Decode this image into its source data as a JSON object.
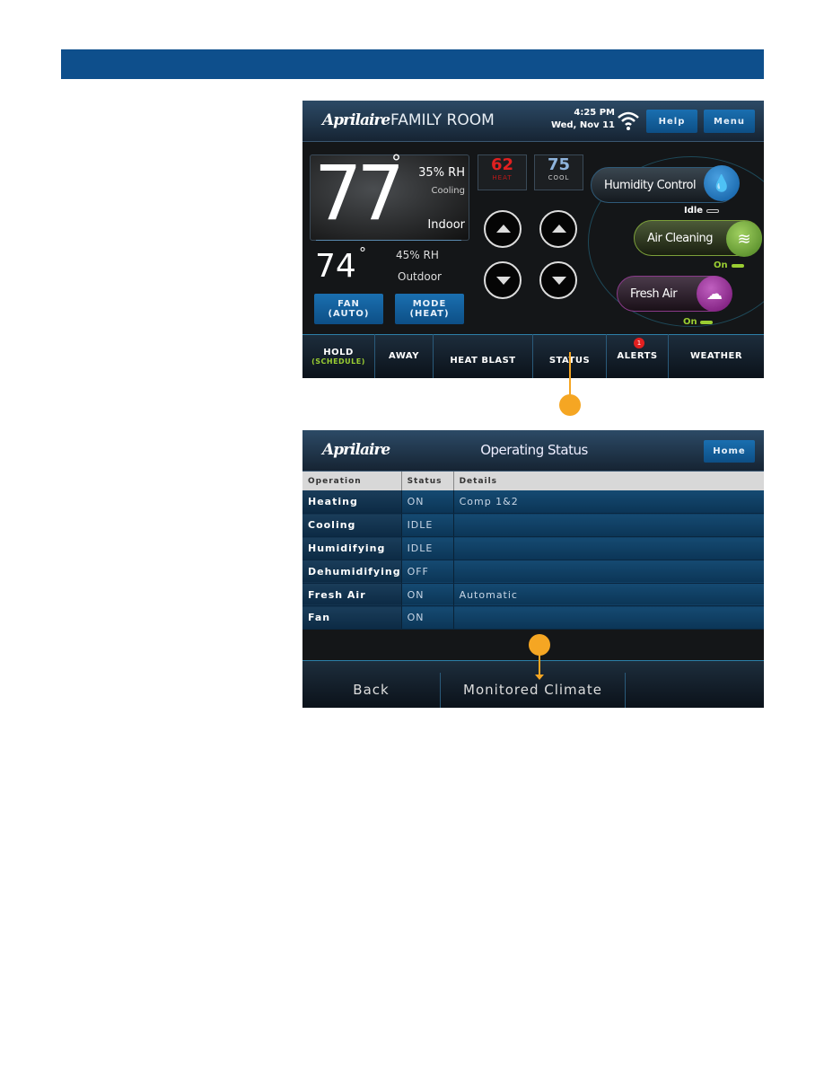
{
  "colors": {
    "header_bar": "#0e4f8c",
    "button_blue": "#1a6fb0",
    "heat": "#e02020",
    "cool": "#8fb4dc",
    "active_green": "#9acd32",
    "marker_orange": "#f5a623"
  },
  "home_screen": {
    "logo": "Aprilaire",
    "room": "FAMILY ROOM",
    "time": "4:25 PM",
    "date": "Wed, Nov 11",
    "help_label": "Help",
    "menu_label": "Menu",
    "indoor": {
      "temp": "77",
      "degree": "°",
      "rh": "35% RH",
      "state": "Cooling",
      "label": "Indoor"
    },
    "outdoor": {
      "temp": "74",
      "degree": "°",
      "rh": "45% RH",
      "label": "Outdoor"
    },
    "fan": {
      "label": "FAN",
      "value": "(AUTO)"
    },
    "mode": {
      "label": "MODE",
      "value": "(HEAT)"
    },
    "heat_setpoint": {
      "value": "62",
      "label": "HEAT"
    },
    "cool_setpoint": {
      "value": "75",
      "label": "COOL"
    },
    "humidity_control": {
      "label": "Humidity Control",
      "status": "Idle",
      "icon": "water-drop-icon"
    },
    "air_cleaning": {
      "label": "Air Cleaning",
      "status": "On",
      "icon": "air-filter-icon"
    },
    "fresh_air": {
      "label": "Fresh Air",
      "status": "On",
      "icon": "cloud-wind-icon"
    },
    "nav": [
      {
        "label": "HOLD",
        "sub": "(SCHEDULE)"
      },
      {
        "label": "AWAY"
      },
      {
        "label": "HEAT BLAST"
      },
      {
        "label": "STATUS"
      },
      {
        "label": "ALERTS",
        "badge": "1"
      },
      {
        "label": "WEATHER"
      }
    ]
  },
  "status_screen": {
    "logo": "Aprilaire",
    "title": "Operating Status",
    "home_label": "Home",
    "columns": [
      "Operation",
      "Status",
      "Details"
    ],
    "rows": [
      [
        "Heating",
        "ON",
        "Comp 1&2"
      ],
      [
        "Cooling",
        "IDLE",
        ""
      ],
      [
        "Humidifying",
        "IDLE",
        ""
      ],
      [
        "Dehumidifying",
        "OFF",
        ""
      ],
      [
        "Fresh Air",
        "ON",
        "Automatic"
      ],
      [
        "Fan",
        "ON",
        ""
      ]
    ],
    "back_label": "Back",
    "climate_label": "Monitored Climate"
  }
}
